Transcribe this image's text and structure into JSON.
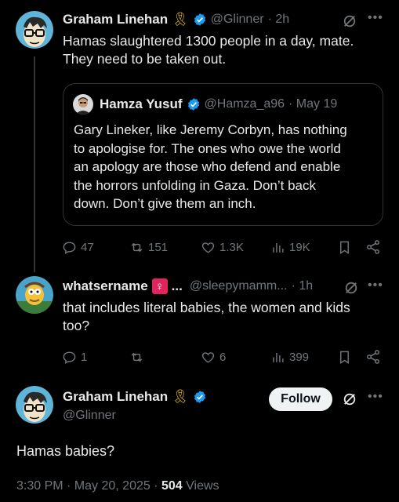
{
  "tweet1": {
    "name": "Graham Linehan",
    "ribbon": "🎗",
    "handle": "@Glinner",
    "time": "· 2h",
    "text_line1": "Hamas slaughtered 1300 people in a day, mate.",
    "text_line2": "They need to be taken out.",
    "quote": {
      "name": "Hamza Yusuf",
      "handle": "@Hamza_a96",
      "time": "· May 19",
      "lines": [
        "Gary Lineker, like Jeremy Corbyn, has nothing",
        "to apologise for. The ones who owe the world",
        "an apology are those who defend and enable",
        "the horrors unfolding in Gaza. Don’t back",
        "down. Don’t give them an inch."
      ]
    },
    "replies": "47",
    "reposts": "151",
    "likes": "1.3K",
    "views": "19K"
  },
  "tweet2": {
    "name": "whatsername",
    "ellipsis": "...",
    "handle": "@sleepymamm...",
    "time": "· 1h",
    "text_line1": "that includes literal babies, the women and kids",
    "text_line2": "too?",
    "replies": "1",
    "reposts": "",
    "likes": "6",
    "views": "399"
  },
  "main": {
    "name": "Graham Linehan",
    "ribbon": "🎗",
    "handle": "@Glinner",
    "follow_label": "Follow",
    "text": "Hamas babies?",
    "timestamp": "3:30 PM · May 20, 2025 · ",
    "views_count": "504",
    "views_label": " Views"
  },
  "colors": {
    "background": "#000000",
    "verified": "#1d9bf0",
    "muted": "#71767b",
    "ribbon": "#f4c430"
  }
}
